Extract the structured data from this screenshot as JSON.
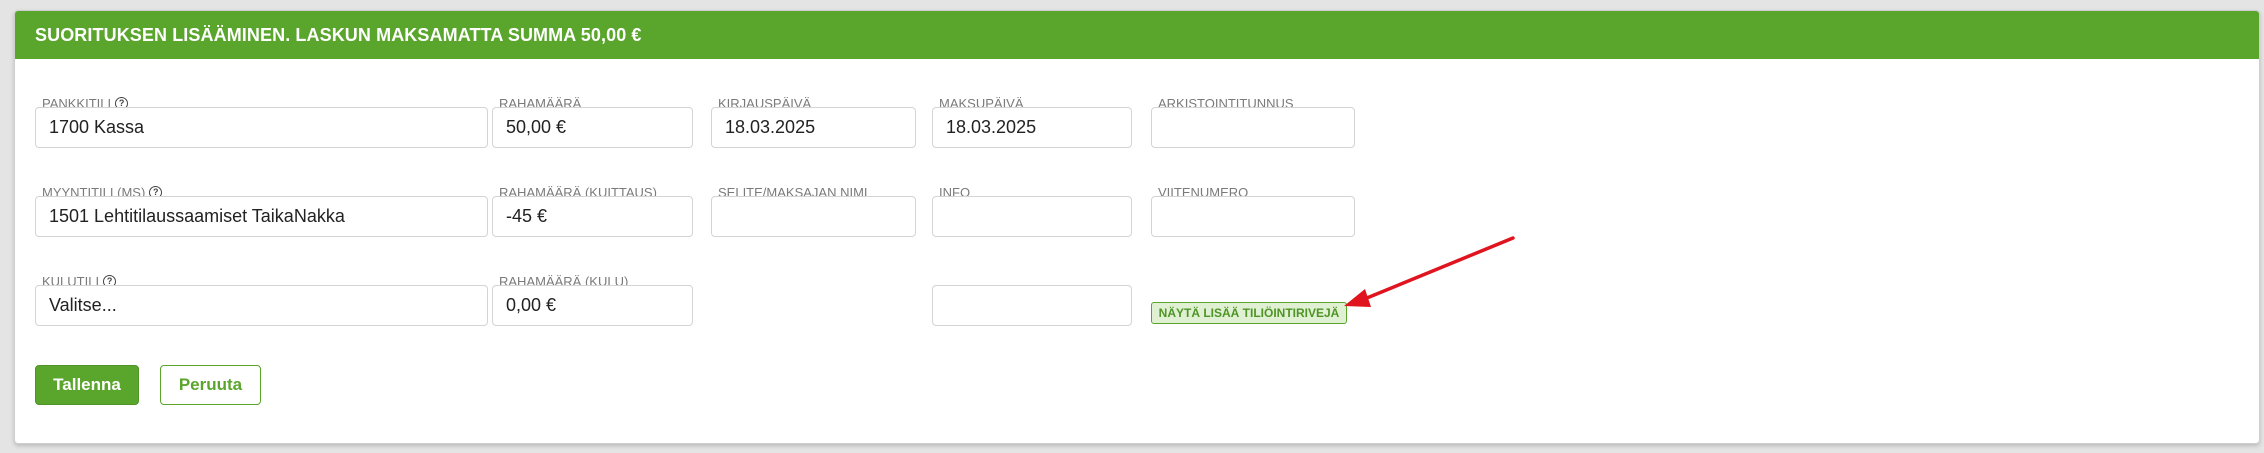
{
  "header": {
    "title": "SUORITUKSEN LISÄÄMINEN. LASKUN MAKSAMATTA SUMMA 50,00 €"
  },
  "row1": {
    "bank_account": {
      "label": "PANKKITILI",
      "value": "1700 Kassa"
    },
    "amount": {
      "label": "RAHAMÄÄRÄ",
      "value": "50,00 €"
    },
    "booking_date": {
      "label": "KIRJAUSPÄIVÄ",
      "value": "18.03.2025"
    },
    "payment_date": {
      "label": "MAKSUPÄIVÄ",
      "value": "18.03.2025"
    },
    "archive_id": {
      "label": "ARKISTOINTITUNNUS",
      "value": ""
    }
  },
  "row2": {
    "sales_account": {
      "label": "MYYNTITILI (MS)",
      "value": "1501 Lehtitilaussaamiset TaikaNakka"
    },
    "amount_offset": {
      "label": "RAHAMÄÄRÄ (KUITTAUS)",
      "value": "-45 €"
    },
    "payer_name": {
      "label": "SELITE/MAKSAJAN NIMI",
      "value": ""
    },
    "info": {
      "label": "INFO",
      "value": ""
    },
    "reference": {
      "label": "VIITENUMERO",
      "value": ""
    }
  },
  "row3": {
    "expense_account": {
      "label": "KULUTILI",
      "value": "Valitse..."
    },
    "amount_expense": {
      "label": "RAHAMÄÄRÄ (KULU)",
      "value": "0,00 €"
    },
    "extra": {
      "value": ""
    },
    "more_rows_label": "NÄYTÄ LISÄÄ TILIÖINTIRIVEJÄ"
  },
  "actions": {
    "save_label": "Tallenna",
    "cancel_label": "Peruuta"
  },
  "icons": {
    "help": "help-icon",
    "annotation": "red-arrow"
  },
  "colors": {
    "accent": "#5aa52c",
    "annotation": "#e0141e"
  }
}
